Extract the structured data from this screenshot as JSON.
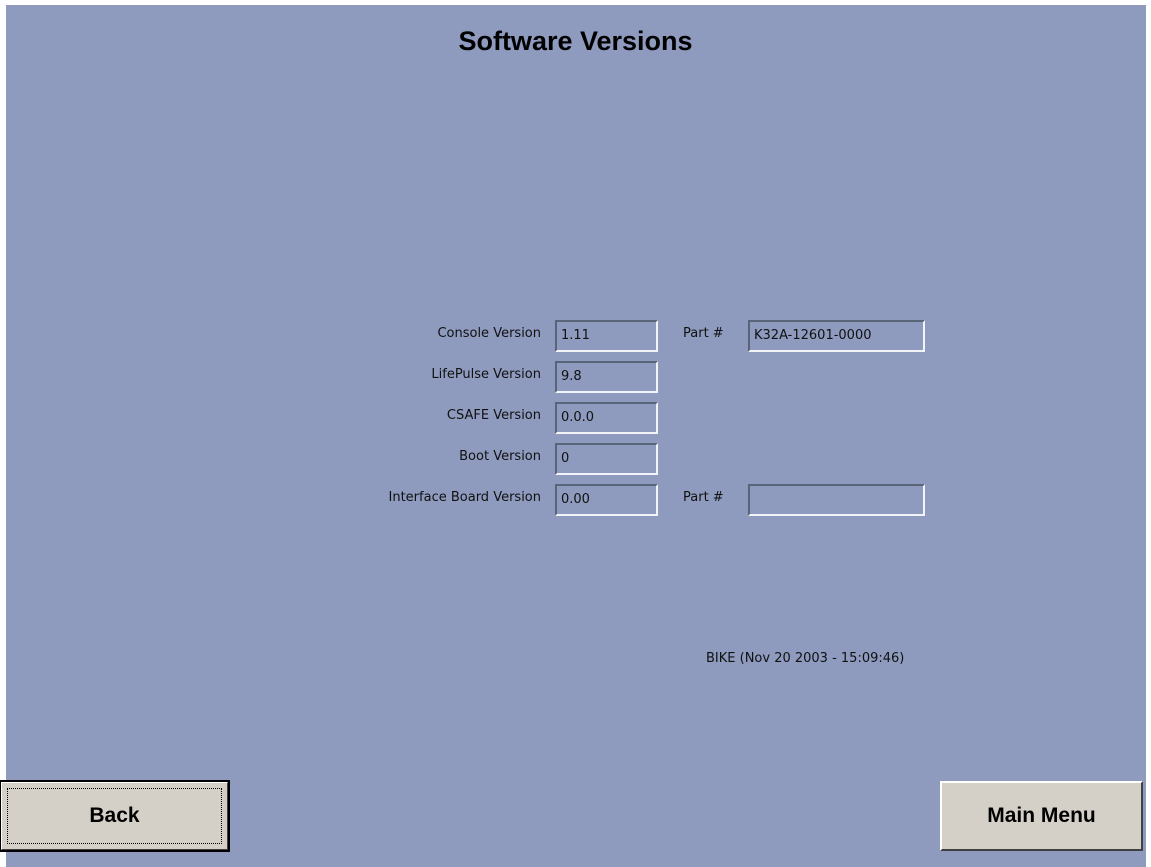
{
  "screen": {
    "title": "Software Versions"
  },
  "versions": [
    {
      "label": "Console Version",
      "value": "1.11"
    },
    {
      "label": "LifePulse Version",
      "value": "9.8"
    },
    {
      "label": "CSAFE Version",
      "value": "0.0.0"
    },
    {
      "label": "Boot Version",
      "value": "0"
    },
    {
      "label": "Interface Board Version",
      "value": "0.00"
    }
  ],
  "parts": {
    "console": {
      "label": "Part #",
      "value": "K32A-12601-0000"
    },
    "interface_board": {
      "label": "Part #",
      "value": ""
    }
  },
  "build_info": "BIKE (Nov 20 2003 - 15:09:46)",
  "buttons": {
    "back": "Back",
    "main_menu": "Main Menu"
  },
  "colors": {
    "background": "#8e9bbf",
    "button_face": "#d4d0c8"
  }
}
